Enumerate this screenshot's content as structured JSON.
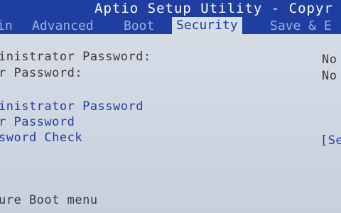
{
  "header": {
    "title": "Aptio Setup Utility - Copyr"
  },
  "tabs": [
    {
      "label": "in"
    },
    {
      "label": "Advanced"
    },
    {
      "label": "Boot"
    },
    {
      "label": "Security"
    },
    {
      "label": "Save & E"
    }
  ],
  "security": {
    "info": [
      {
        "label": "inistrator Password:",
        "value": "No"
      },
      {
        "label": "r Password:",
        "value": "No"
      }
    ],
    "actions": [
      {
        "label": "inistrator Password"
      },
      {
        "label": "r Password"
      },
      {
        "label": "sword Check",
        "value": "[Se"
      }
    ],
    "bottom_item": "ure Boot menu"
  }
}
